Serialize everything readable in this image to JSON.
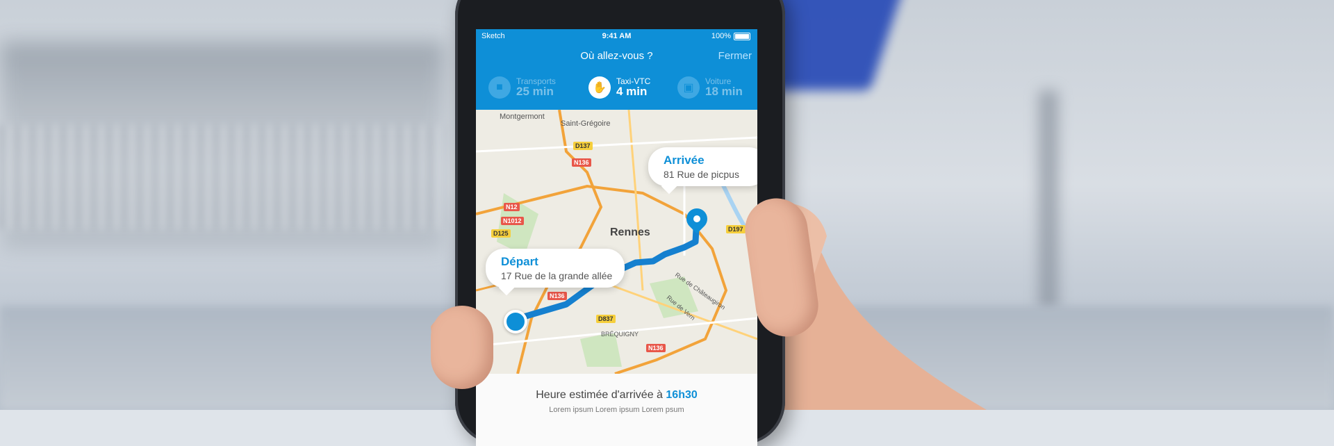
{
  "status_bar": {
    "carrier": "Sketch",
    "time": "9:41 AM",
    "battery": "100%"
  },
  "nav": {
    "title": "Où allez-vous ?",
    "close_label": "Fermer"
  },
  "modes": [
    {
      "label": "Transports",
      "value": "25 min",
      "icon": "bus-icon",
      "active": false
    },
    {
      "label": "Taxi-VTC",
      "value": "4 min",
      "icon": "taxi-hail-icon",
      "active": true
    },
    {
      "label": "Voiture",
      "value": "18 min",
      "icon": "car-icon",
      "active": false
    }
  ],
  "map": {
    "places": [
      "Montgermont",
      "Saint-Grégoire",
      "BRÉQUIGNY",
      "Rue de Châteaugiron",
      "Rue de Vern"
    ],
    "city": "Rennes",
    "roads": [
      "D137",
      "N136",
      "N12",
      "N1012",
      "D125",
      "D197",
      "N136",
      "D837",
      "N136"
    ],
    "provider": "Google"
  },
  "arrival": {
    "heading": "Arrivée",
    "address": "81 Rue de picpus"
  },
  "departure": {
    "heading": "Départ",
    "address": "17 Rue de la grande allée"
  },
  "eta": {
    "prefix": "Heure estimée d'arrivée à",
    "time": "16h30",
    "subtitle": "Lorem ipsum Lorem ipsum Lorem psum"
  },
  "colors": {
    "brand_blue": "#0e8fd7",
    "map_bg": "#eeece4",
    "road_orange": "#f2a33a"
  }
}
